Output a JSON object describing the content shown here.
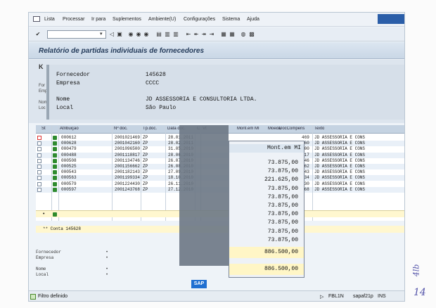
{
  "menu": [
    "Lista",
    "Processar",
    "Ir para",
    "Suplementos",
    "Ambiente(U)",
    "Configurações",
    "Sistema",
    "Ajuda"
  ],
  "title": "Relatório de partidas individuais de fornecedores",
  "header": {
    "fornecedor_label": "Fornecedor",
    "fornecedor_value": "145628",
    "empresa_label": "Empresa",
    "empresa_value": "CCCC",
    "nome_label": "Nome",
    "nome_value": "JD ASSESSORIA E CONSULTORIA LTDA.",
    "local_label": "Local",
    "local_value": "São Paulo"
  },
  "table": {
    "columns": [
      "St",
      "Atribuição",
      "Nº doc.",
      "Tp.doc.",
      "Data doc.",
      "C",
      "Vt",
      "Mont.em MI",
      "Moeda",
      "DocCompens",
      "Texto"
    ],
    "rows": [
      {
        "atrib": "000612",
        "doc": "2001021469",
        "tp": "ZP",
        "data": "28.01.2011",
        "comp": "469",
        "texto": "JD ASSESSORIA E CONS"
      },
      {
        "atrib": "000628",
        "doc": "2001042160",
        "tp": "ZP",
        "data": "28.02.2011",
        "comp": "160",
        "texto": "JD ASSESSORIA E CONS"
      },
      {
        "atrib": "000479",
        "doc": "2001096500",
        "tp": "ZP",
        "data": "31.05.2010",
        "comp": "500",
        "texto": "JD ASSESSORIA E CONS"
      },
      {
        "atrib": "000488",
        "doc": "2001118817",
        "tp": "ZP",
        "data": "28.06.2010",
        "comp": "817",
        "texto": "JD ASSESSORIA E CONS"
      },
      {
        "atrib": "000508",
        "doc": "2001134746",
        "tp": "ZP",
        "data": "26.07.2010",
        "comp": "746",
        "texto": "JD ASSESSORIA E CONS"
      },
      {
        "atrib": "000525",
        "doc": "2001156662",
        "tp": "ZP",
        "data": "26.08.2010",
        "comp": "662",
        "texto": "JD ASSESSORIA E CONS"
      },
      {
        "atrib": "000543",
        "doc": "2001182143",
        "tp": "ZP",
        "data": "27.09.2010",
        "comp": "143",
        "texto": "JD ASSESSORIA E CONS"
      },
      {
        "atrib": "000563",
        "doc": "2001199334",
        "tp": "ZP",
        "data": "18.10.2010",
        "comp": "334",
        "texto": "JD ASSESSORIA E CONS"
      },
      {
        "atrib": "000579",
        "doc": "2001224430",
        "tp": "ZP",
        "data": "26.11.2010",
        "comp": "430",
        "texto": "JD ASSESSORIA E CONS"
      },
      {
        "atrib": "000597",
        "doc": "2001243768",
        "tp": "ZP",
        "data": "27.12.2010",
        "comp": "768",
        "texto": "JD ASSESSORIA E CONS"
      }
    ],
    "conta_line": "** Conta 145628"
  },
  "amounts": {
    "header": "Mont.em MI",
    "values": [
      "73.875,00",
      "73.875,00",
      "221.625,00",
      "73.875,00",
      "73.875,00",
      "73.875,00",
      "73.875,00",
      "73.875,00",
      "73.875,00",
      "73.875,00"
    ],
    "subtotal": "886.500,00",
    "total": "886.500,00"
  },
  "lower_labels": [
    "Fornecedor",
    "Empresa",
    "Nome",
    "Local"
  ],
  "status": {
    "left": "Filtro definido",
    "tcode": "FBL1N",
    "server": "sapaf21p",
    "mode": "INS"
  },
  "handwritten": [
    "14",
    "4lb"
  ]
}
